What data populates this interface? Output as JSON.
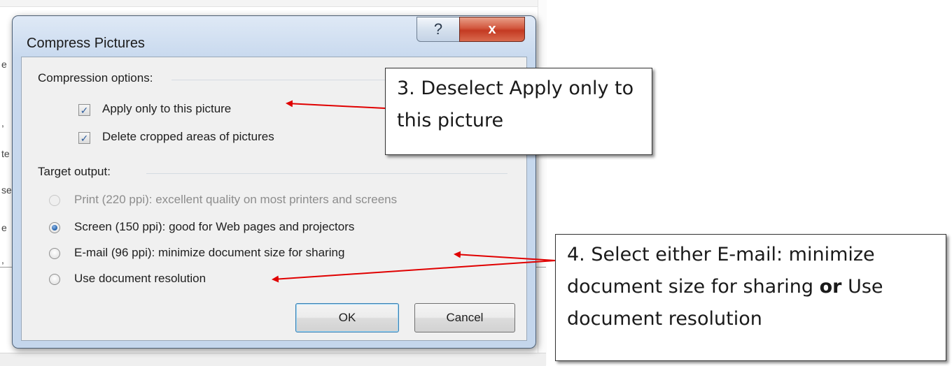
{
  "dialog": {
    "title": "Compress Pictures",
    "help_glyph": "?",
    "close_glyph": "x",
    "compression_group": {
      "label": "Compression options:",
      "options": [
        {
          "label": "Apply only to this picture",
          "checked": true,
          "check_glyph": "✓"
        },
        {
          "label": "Delete cropped areas of pictures",
          "checked": true,
          "check_glyph": "✓"
        }
      ]
    },
    "target_group": {
      "label": "Target output:",
      "options": [
        {
          "label": "Print (220 ppi): excellent quality on most printers and screens",
          "selected": false,
          "enabled": false
        },
        {
          "label": "Screen (150 ppi): good for Web pages and projectors",
          "selected": true,
          "enabled": true
        },
        {
          "label": "E-mail (96 ppi): minimize document size for sharing",
          "selected": false,
          "enabled": true
        },
        {
          "label": "Use document resolution",
          "selected": false,
          "enabled": true
        }
      ]
    },
    "ok_label": "OK",
    "cancel_label": "Cancel"
  },
  "background_fragments": [
    "e",
    ",",
    "te",
    "se",
    "e",
    ","
  ],
  "callouts": {
    "step3": "3. Deselect Apply only to this picture",
    "step4_prefix": "4. Select either E-mail: minimize document size for sharing ",
    "step4_bold": "or",
    "step4_suffix": " Use document resolution"
  },
  "colors": {
    "arrow": "#e00000",
    "close_button": "#c43a22",
    "radio_selected": "#1f5ea8"
  },
  "icons": {
    "help": "question-mark-icon",
    "close": "close-icon"
  }
}
